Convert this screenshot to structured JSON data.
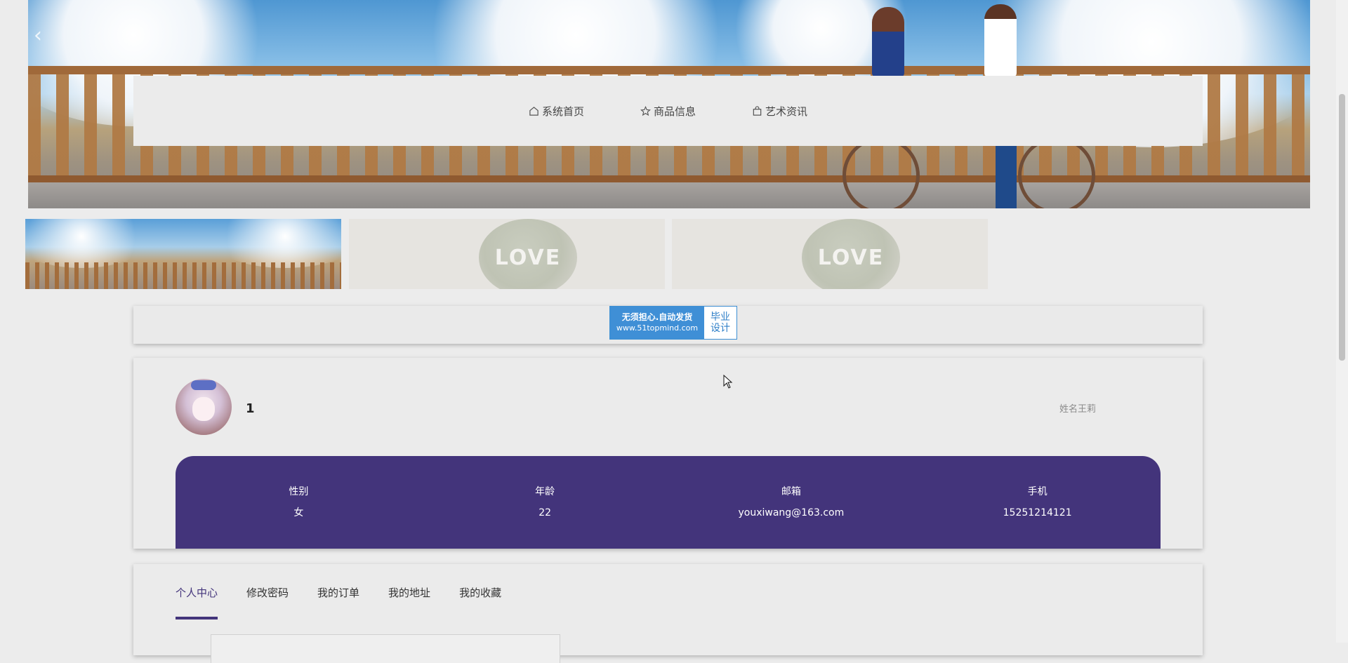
{
  "nav": {
    "items": [
      {
        "label": "系统首页",
        "icon": "home-icon"
      },
      {
        "label": "商品信息",
        "icon": "star-icon"
      },
      {
        "label": "艺术资讯",
        "icon": "bag-icon"
      }
    ]
  },
  "thumbnails": {
    "love_text": "LOVE"
  },
  "ad": {
    "line1": "无须担心.自动发货",
    "line2": "www.51topmind.com",
    "side1": "毕业",
    "side2": "设计"
  },
  "profile": {
    "name": "1",
    "real_name": "姓名王莉",
    "fields": [
      {
        "label": "性别",
        "value": "女"
      },
      {
        "label": "年龄",
        "value": "22"
      },
      {
        "label": "邮箱",
        "value": "youxiwang@163.com"
      },
      {
        "label": "手机",
        "value": "15251214121"
      }
    ]
  },
  "tabs": [
    {
      "label": "个人中心",
      "active": true
    },
    {
      "label": "修改密码",
      "active": false
    },
    {
      "label": "我的订单",
      "active": false
    },
    {
      "label": "我的地址",
      "active": false
    },
    {
      "label": "我的收藏",
      "active": false
    }
  ],
  "colors": {
    "accent": "#43347b",
    "page_bg": "#ececec"
  }
}
